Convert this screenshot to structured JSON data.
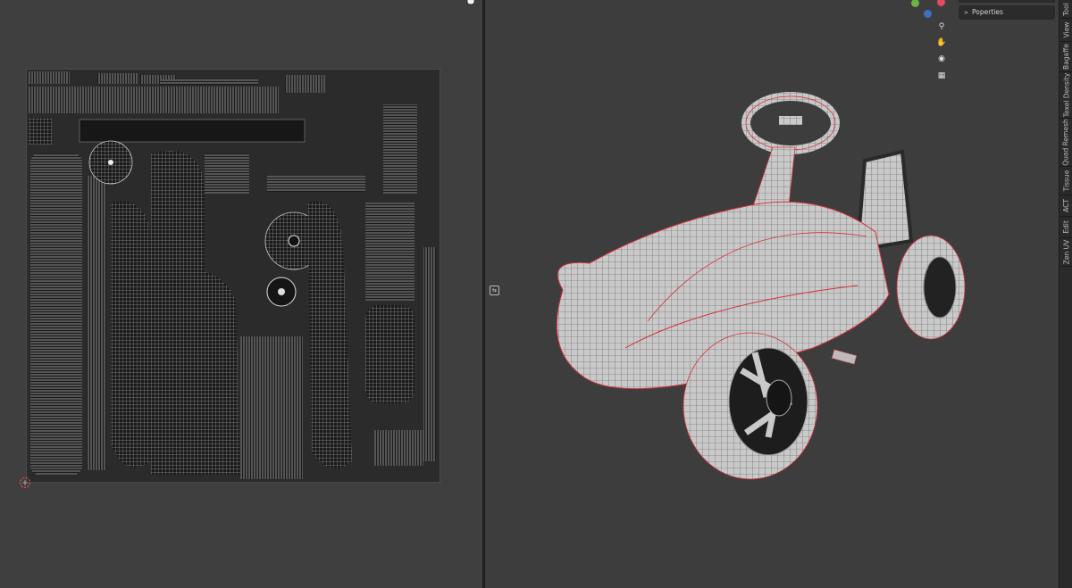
{
  "uv_editor": {
    "grid_color": "#d9d9d9",
    "background": "#3f3f3f"
  },
  "viewport": {
    "background": "#3d3d3d",
    "wire_color": "#2a2a2a",
    "seam_color": "#d6303a"
  },
  "properties_panel": {
    "header": "Poperties"
  },
  "sidebar_tabs": [
    "Tool",
    "View",
    "Bagaffe",
    "Texel Density",
    "Quad Remesh",
    "Tissue",
    "ACT",
    "Edit",
    "Zen UV"
  ],
  "nav_icons": [
    "zoom-icon",
    "hand-pan-icon",
    "camera-icon",
    "grid-view-icon"
  ],
  "gizmo_colors": {
    "y_axis": "#6bb347",
    "x_axis": "#e84a5a",
    "z_axis": "#3f6fc0"
  }
}
